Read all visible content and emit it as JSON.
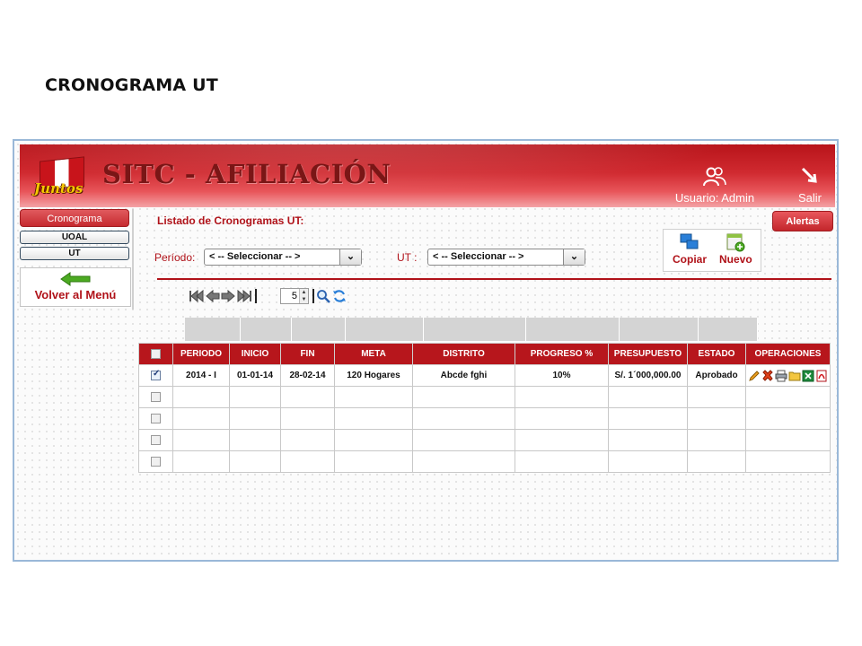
{
  "page": {
    "title": "CRONOGRAMA UT"
  },
  "header": {
    "logo_text": "Juntos",
    "app_title": "SITC - AFILIACIÓN",
    "user_label": "Usuario: Admin",
    "exit_label": "Salir"
  },
  "sidebar": {
    "section": "Cronograma",
    "items": [
      "UOAL",
      "UT"
    ],
    "back_label": "Volver al Menú"
  },
  "main": {
    "list_title": "Listado de Cronogramas UT:",
    "alerts_label": "Alertas",
    "filters": {
      "period_label": "Período:",
      "period_value": "< -- Seleccionar -- >",
      "ut_label": "UT :",
      "ut_value": "< -- Seleccionar -- >"
    },
    "actions": {
      "copy_label": "Copiar",
      "new_label": "Nuevo"
    },
    "pager": {
      "page_size": "5"
    }
  },
  "table": {
    "columns": [
      "PERIODO",
      "INICIO",
      "FIN",
      "META",
      "DISTRITO",
      "PROGRESO %",
      "PRESUPUESTO",
      "ESTADO",
      "OPERACIONES"
    ],
    "rows": [
      {
        "checked": true,
        "cells": [
          "2014 - I",
          "01-01-14",
          "28-02-14",
          "120 Hogares",
          "Abcde fghi",
          "10%",
          "S/. 1´000,000.00",
          "Aprobado"
        ]
      }
    ],
    "empty_rows": 4
  },
  "colors": {
    "brand_red": "#b7161c",
    "header_red": "#d02a30",
    "frame_border": "#9ab8d8"
  },
  "icons": [
    "user-icon",
    "exit-icon",
    "back-arrow-icon",
    "copy-icon",
    "new-icon",
    "first-page-icon",
    "prev-page-icon",
    "next-page-icon",
    "last-page-icon",
    "search-icon",
    "refresh-icon",
    "edit-icon",
    "delete-icon",
    "print-icon",
    "folder-icon",
    "excel-icon",
    "pdf-icon"
  ]
}
